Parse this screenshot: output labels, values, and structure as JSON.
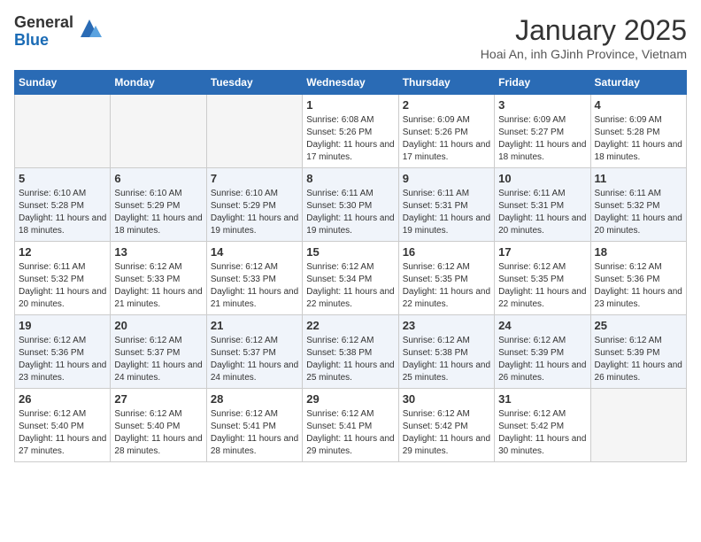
{
  "logo": {
    "general": "General",
    "blue": "Blue"
  },
  "header": {
    "month": "January 2025",
    "location": "Hoai An, inh GJinh Province, Vietnam"
  },
  "weekdays": [
    "Sunday",
    "Monday",
    "Tuesday",
    "Wednesday",
    "Thursday",
    "Friday",
    "Saturday"
  ],
  "weeks": [
    [
      {
        "day": "",
        "info": ""
      },
      {
        "day": "",
        "info": ""
      },
      {
        "day": "",
        "info": ""
      },
      {
        "day": "1",
        "info": "Sunrise: 6:08 AM\nSunset: 5:26 PM\nDaylight: 11 hours and 17 minutes."
      },
      {
        "day": "2",
        "info": "Sunrise: 6:09 AM\nSunset: 5:26 PM\nDaylight: 11 hours and 17 minutes."
      },
      {
        "day": "3",
        "info": "Sunrise: 6:09 AM\nSunset: 5:27 PM\nDaylight: 11 hours and 18 minutes."
      },
      {
        "day": "4",
        "info": "Sunrise: 6:09 AM\nSunset: 5:28 PM\nDaylight: 11 hours and 18 minutes."
      }
    ],
    [
      {
        "day": "5",
        "info": "Sunrise: 6:10 AM\nSunset: 5:28 PM\nDaylight: 11 hours and 18 minutes."
      },
      {
        "day": "6",
        "info": "Sunrise: 6:10 AM\nSunset: 5:29 PM\nDaylight: 11 hours and 18 minutes."
      },
      {
        "day": "7",
        "info": "Sunrise: 6:10 AM\nSunset: 5:29 PM\nDaylight: 11 hours and 19 minutes."
      },
      {
        "day": "8",
        "info": "Sunrise: 6:11 AM\nSunset: 5:30 PM\nDaylight: 11 hours and 19 minutes."
      },
      {
        "day": "9",
        "info": "Sunrise: 6:11 AM\nSunset: 5:31 PM\nDaylight: 11 hours and 19 minutes."
      },
      {
        "day": "10",
        "info": "Sunrise: 6:11 AM\nSunset: 5:31 PM\nDaylight: 11 hours and 20 minutes."
      },
      {
        "day": "11",
        "info": "Sunrise: 6:11 AM\nSunset: 5:32 PM\nDaylight: 11 hours and 20 minutes."
      }
    ],
    [
      {
        "day": "12",
        "info": "Sunrise: 6:11 AM\nSunset: 5:32 PM\nDaylight: 11 hours and 20 minutes."
      },
      {
        "day": "13",
        "info": "Sunrise: 6:12 AM\nSunset: 5:33 PM\nDaylight: 11 hours and 21 minutes."
      },
      {
        "day": "14",
        "info": "Sunrise: 6:12 AM\nSunset: 5:33 PM\nDaylight: 11 hours and 21 minutes."
      },
      {
        "day": "15",
        "info": "Sunrise: 6:12 AM\nSunset: 5:34 PM\nDaylight: 11 hours and 22 minutes."
      },
      {
        "day": "16",
        "info": "Sunrise: 6:12 AM\nSunset: 5:35 PM\nDaylight: 11 hours and 22 minutes."
      },
      {
        "day": "17",
        "info": "Sunrise: 6:12 AM\nSunset: 5:35 PM\nDaylight: 11 hours and 22 minutes."
      },
      {
        "day": "18",
        "info": "Sunrise: 6:12 AM\nSunset: 5:36 PM\nDaylight: 11 hours and 23 minutes."
      }
    ],
    [
      {
        "day": "19",
        "info": "Sunrise: 6:12 AM\nSunset: 5:36 PM\nDaylight: 11 hours and 23 minutes."
      },
      {
        "day": "20",
        "info": "Sunrise: 6:12 AM\nSunset: 5:37 PM\nDaylight: 11 hours and 24 minutes."
      },
      {
        "day": "21",
        "info": "Sunrise: 6:12 AM\nSunset: 5:37 PM\nDaylight: 11 hours and 24 minutes."
      },
      {
        "day": "22",
        "info": "Sunrise: 6:12 AM\nSunset: 5:38 PM\nDaylight: 11 hours and 25 minutes."
      },
      {
        "day": "23",
        "info": "Sunrise: 6:12 AM\nSunset: 5:38 PM\nDaylight: 11 hours and 25 minutes."
      },
      {
        "day": "24",
        "info": "Sunrise: 6:12 AM\nSunset: 5:39 PM\nDaylight: 11 hours and 26 minutes."
      },
      {
        "day": "25",
        "info": "Sunrise: 6:12 AM\nSunset: 5:39 PM\nDaylight: 11 hours and 26 minutes."
      }
    ],
    [
      {
        "day": "26",
        "info": "Sunrise: 6:12 AM\nSunset: 5:40 PM\nDaylight: 11 hours and 27 minutes."
      },
      {
        "day": "27",
        "info": "Sunrise: 6:12 AM\nSunset: 5:40 PM\nDaylight: 11 hours and 28 minutes."
      },
      {
        "day": "28",
        "info": "Sunrise: 6:12 AM\nSunset: 5:41 PM\nDaylight: 11 hours and 28 minutes."
      },
      {
        "day": "29",
        "info": "Sunrise: 6:12 AM\nSunset: 5:41 PM\nDaylight: 11 hours and 29 minutes."
      },
      {
        "day": "30",
        "info": "Sunrise: 6:12 AM\nSunset: 5:42 PM\nDaylight: 11 hours and 29 minutes."
      },
      {
        "day": "31",
        "info": "Sunrise: 6:12 AM\nSunset: 5:42 PM\nDaylight: 11 hours and 30 minutes."
      },
      {
        "day": "",
        "info": ""
      }
    ]
  ]
}
